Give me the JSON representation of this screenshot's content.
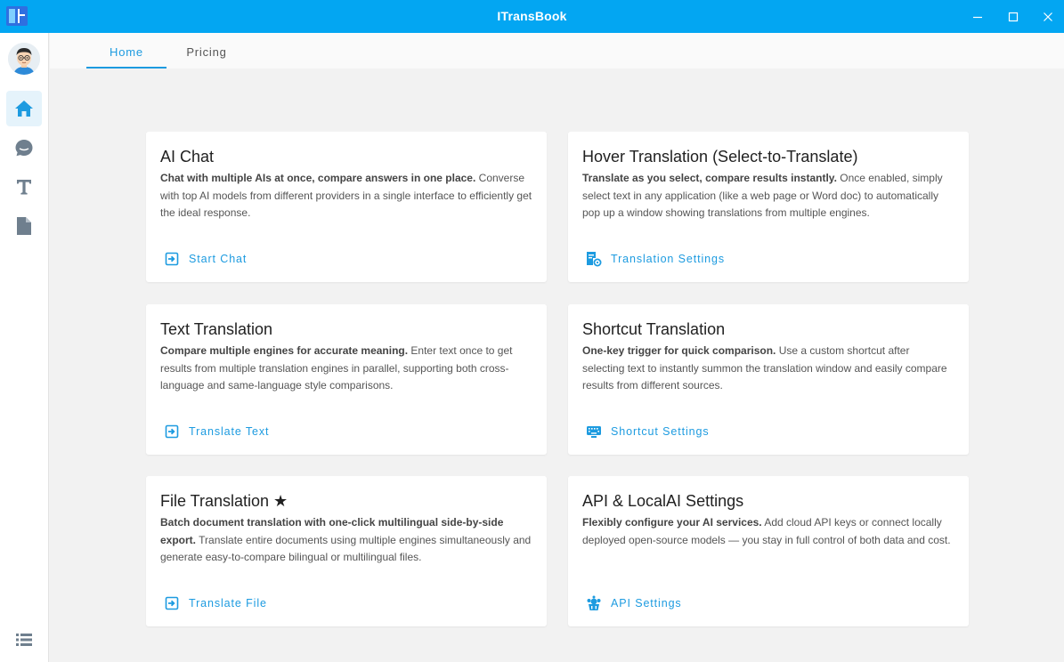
{
  "app": {
    "title": "ITransBook"
  },
  "window": {
    "minimize_icon": "minimize-icon",
    "maximize_icon": "maximize-icon",
    "close_icon": "close-icon"
  },
  "sidebar": {
    "items": [
      {
        "id": "home",
        "icon": "home-icon",
        "active": true
      },
      {
        "id": "chat",
        "icon": "chat-bubble-icon",
        "active": false
      },
      {
        "id": "text",
        "icon": "text-t-icon",
        "active": false
      },
      {
        "id": "file",
        "icon": "document-icon",
        "active": false
      }
    ],
    "bottom_icon": "list-menu-icon"
  },
  "tabs": [
    {
      "label": "Home",
      "active": true
    },
    {
      "label": "Pricing",
      "active": false
    }
  ],
  "cards": [
    {
      "title": "AI Chat",
      "lead": "Chat with multiple AIs at once, compare answers in one place.",
      "body": " Converse with top AI models from different providers in a single interface to efficiently get the ideal response.",
      "action": "Start Chat",
      "action_icon": "enter-arrow-icon"
    },
    {
      "title": "Hover Translation (Select-to-Translate)",
      "lead": "Translate as you select, compare results instantly.",
      "body": " Once enabled, simply select text in any application (like a web page or Word doc) to automatically pop up a window showing translations from multiple engines.",
      "action": "Translation Settings",
      "action_icon": "settings-document-icon"
    },
    {
      "title": "Text Translation",
      "lead": "Compare multiple engines for accurate meaning.",
      "body": " Enter text once to get results from multiple translation engines in parallel, supporting both cross-language and same-language style comparisons.",
      "action": "Translate Text",
      "action_icon": "enter-arrow-icon"
    },
    {
      "title": "Shortcut Translation",
      "lead": "One-key trigger for quick comparison.",
      "body": " Use a custom shortcut after selecting text to instantly summon the translation window and easily compare results from different sources.",
      "action": "Shortcut Settings",
      "action_icon": "keyboard-icon"
    },
    {
      "title": "File Translation ★",
      "lead": "Batch document translation with one-click multilingual side-by-side export.",
      "body": " Translate entire documents using multiple engines simultaneously and generate easy-to-compare bilingual or multilingual files.",
      "action": "Translate File",
      "action_icon": "enter-arrow-icon"
    },
    {
      "title": "API & LocalAI Settings",
      "lead": "Flexibly configure your AI services.",
      "body": " Add cloud API keys or connect locally deployed open-source models — you stay in full control of both data and cost.",
      "action": "API Settings",
      "action_icon": "api-icon"
    }
  ],
  "colors": {
    "titlebar": "#03a6f2",
    "accent": "#1d9be0",
    "background": "#f2f2f2"
  }
}
